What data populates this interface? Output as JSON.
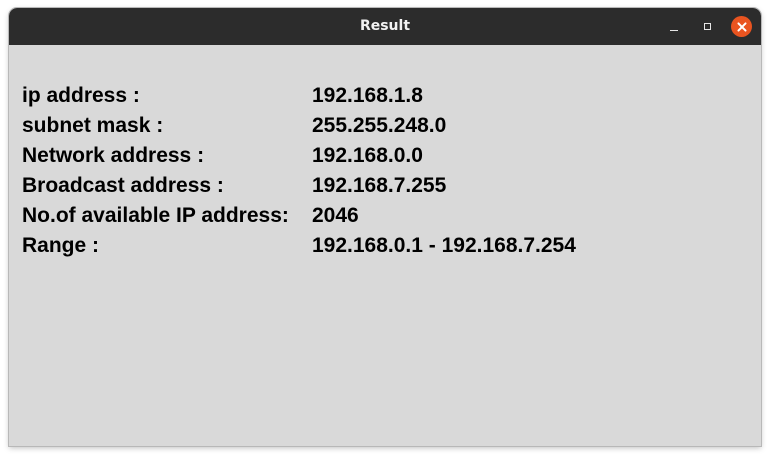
{
  "window": {
    "title": "Result"
  },
  "results": [
    {
      "label": "ip address :",
      "value": "192.168.1.8"
    },
    {
      "label": "subnet mask :",
      "value": "255.255.248.0"
    },
    {
      "label": "Network address :",
      "value": "192.168.0.0"
    },
    {
      "label": "Broadcast address :",
      "value": "192.168.7.255"
    },
    {
      "label": "No.of available IP address:",
      "value": "2046"
    },
    {
      "label": "Range :",
      "value": "192.168.0.1 - 192.168.7.254"
    }
  ],
  "icons": {
    "minimize": "minimize-icon",
    "maximize": "maximize-icon",
    "close": "close-icon"
  },
  "colors": {
    "titlebar": "#2c2c2c",
    "background": "#d9d9d9",
    "close_button": "#e95420"
  }
}
